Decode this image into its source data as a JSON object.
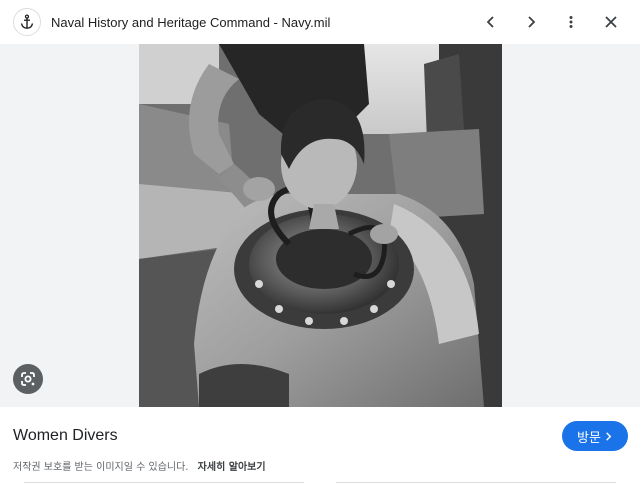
{
  "header": {
    "site_name": "Naval History and Heritage Command - Navy.mil",
    "favicon_icon": "anchor-icon",
    "prev_icon": "chevron-left-icon",
    "next_icon": "chevron-right-icon",
    "more_icon": "more-vert-icon",
    "close_icon": "close-icon"
  },
  "image": {
    "lens_icon": "google-lens-icon",
    "background_color": "#f1f3f4"
  },
  "info": {
    "title": "Women Divers",
    "visit_label": "방문",
    "visit_icon": "chevron-right-icon",
    "copyright_text": "저작권 보호를 받는 이미지일 수 있습니다.",
    "learn_more_label": "자세히 알아보기"
  },
  "colors": {
    "accent": "#1a73e8",
    "text_primary": "#202124",
    "text_secondary": "#5f6368"
  }
}
